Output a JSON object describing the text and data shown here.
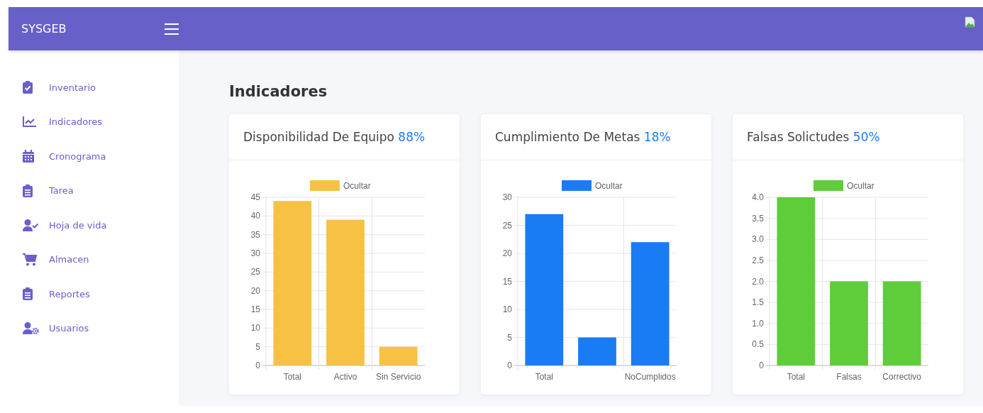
{
  "header": {
    "brand": "SYSGEB"
  },
  "sidebar": {
    "items": [
      {
        "label": "Inventario"
      },
      {
        "label": "Indicadores"
      },
      {
        "label": "Cronograma"
      },
      {
        "label": "Tarea"
      },
      {
        "label": "Hoja de vida"
      },
      {
        "label": "Almacen"
      },
      {
        "label": "Reportes"
      },
      {
        "label": "Usuarios"
      }
    ]
  },
  "page_title": "Indicadores",
  "cards": [
    {
      "title": "Disponibilidad De Equipo",
      "percent": "88%",
      "chart_data": {
        "type": "bar",
        "categories": [
          "Total",
          "Activo",
          "Sin Servicio"
        ],
        "grid": true,
        "ylim": [
          0,
          45
        ],
        "yticks": [
          0,
          5,
          10,
          15,
          20,
          25,
          30,
          35,
          40,
          45
        ],
        "series": [
          {
            "name": "Ocultar",
            "color": "#f7c144",
            "values": [
              44,
              39,
              5
            ]
          }
        ]
      }
    },
    {
      "title": "Cumplimiento De Metas",
      "percent": "18%",
      "chart_data": {
        "type": "bar",
        "categories": [
          "Total",
          null,
          "NoCumplidos"
        ],
        "grid": true,
        "ylim": [
          0,
          30
        ],
        "yticks": [
          0,
          5,
          10,
          15,
          20,
          25,
          30
        ],
        "series": [
          {
            "name": "Ocultar",
            "color": "#1a7cf5",
            "values": [
              27,
              5,
              22
            ]
          }
        ]
      }
    },
    {
      "title": "Falsas Solictudes",
      "percent": "50%",
      "chart_data": {
        "type": "bar",
        "categories": [
          "Total",
          "Falsas",
          "Correctivo"
        ],
        "grid": true,
        "ylim": [
          0,
          4
        ],
        "yticks": [
          0,
          0.5,
          {
            "value": 1,
            "label": "1.0"
          },
          1.5,
          {
            "value": 2,
            "label": "2.0"
          },
          2.5,
          {
            "value": 3,
            "label": "3.0"
          },
          3.5,
          {
            "value": 4,
            "label": "4.0"
          }
        ],
        "series": [
          {
            "name": "Ocultar",
            "color": "#5fcd3a",
            "values": [
              4,
              2,
              2
            ]
          }
        ]
      }
    }
  ]
}
